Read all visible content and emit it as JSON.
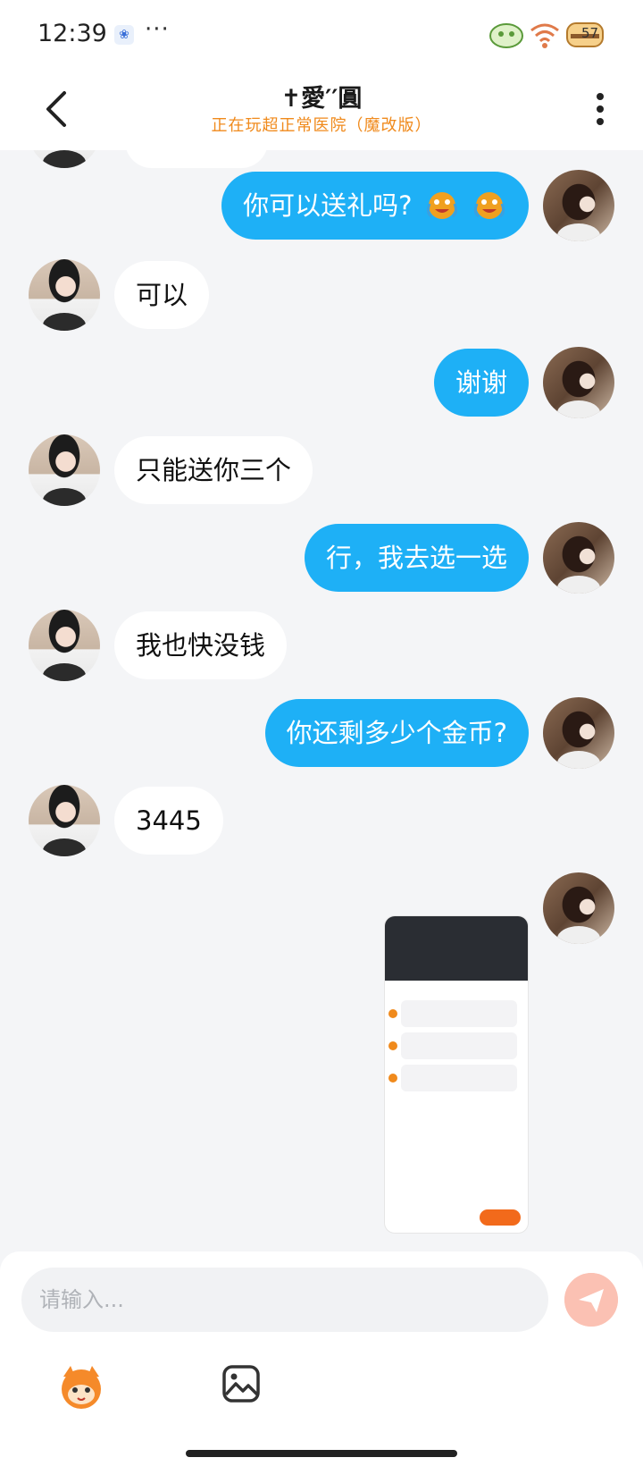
{
  "status": {
    "time": "12:39",
    "battery": "57",
    "dots": "···"
  },
  "header": {
    "title": "✝愛′′圓",
    "subtitle": "正在玩超正常医院（魔改版）"
  },
  "messages": [
    {
      "from": "me",
      "text": "你可以送礼吗?"
    },
    {
      "from": "other",
      "text": "可以"
    },
    {
      "from": "me",
      "text": "谢谢"
    },
    {
      "from": "other",
      "text": "只能送你三个"
    },
    {
      "from": "me",
      "text": "行，我去选一选"
    },
    {
      "from": "other",
      "text": "我也快没钱"
    },
    {
      "from": "me",
      "text": "你还剩多少个金币?"
    },
    {
      "from": "other",
      "text": "3445"
    },
    {
      "from": "me",
      "type": "image"
    }
  ],
  "composer": {
    "placeholder": "请输入..."
  },
  "colors": {
    "me_bubble": "#1eb0f6",
    "accent": "#f08a1c",
    "send": "#fbc1b3"
  }
}
